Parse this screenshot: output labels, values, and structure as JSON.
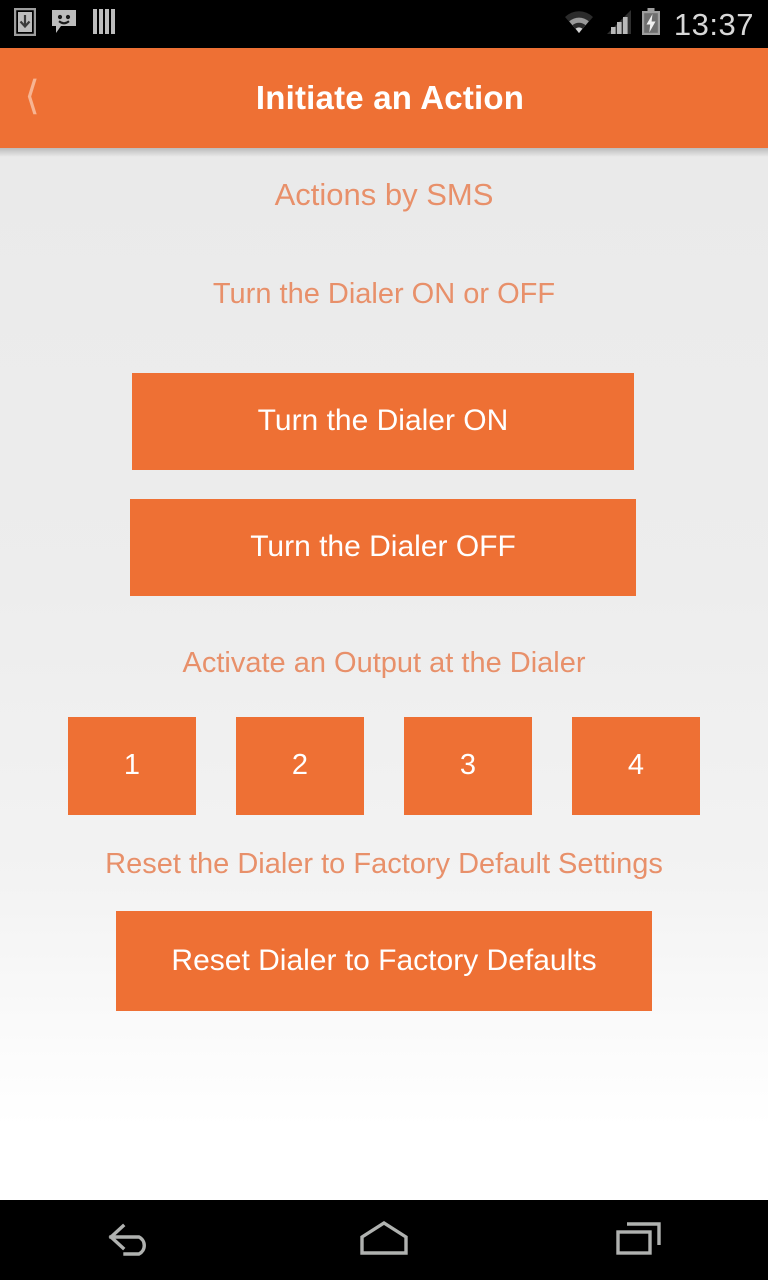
{
  "status_bar": {
    "icons_left": [
      "download-icon",
      "sms-smiley-icon",
      "bars-icon"
    ],
    "icons_right": [
      "wifi-icon",
      "signal-icon",
      "battery-charging-icon"
    ],
    "clock": "13:37"
  },
  "action_bar": {
    "back_icon": "back-chevron-icon",
    "title": "Initiate an Action"
  },
  "theme": {
    "orange": "#ee7034",
    "label_orange": "#e8906a",
    "button_text": "#ffffff",
    "background_top": "#eaeaea",
    "background_bottom": "#ffffff",
    "status_bar_bg": "#000000"
  },
  "main": {
    "page_heading": "Actions by SMS",
    "sections": [
      {
        "label": "Turn the Dialer ON or OFF",
        "buttons": [
          {
            "label": "Turn the Dialer ON"
          },
          {
            "label": "Turn the Dialer OFF"
          }
        ]
      },
      {
        "label": "Activate an Output at the Dialer",
        "buttons": [
          {
            "label": "1"
          },
          {
            "label": "2"
          },
          {
            "label": "3"
          },
          {
            "label": "4"
          }
        ]
      },
      {
        "label": "Reset the Dialer to Factory Default Settings",
        "buttons": [
          {
            "label": "Reset Dialer to Factory Defaults"
          }
        ]
      }
    ]
  },
  "nav_bar": {
    "items": [
      "back-nav-icon",
      "home-nav-icon",
      "recents-nav-icon"
    ]
  }
}
